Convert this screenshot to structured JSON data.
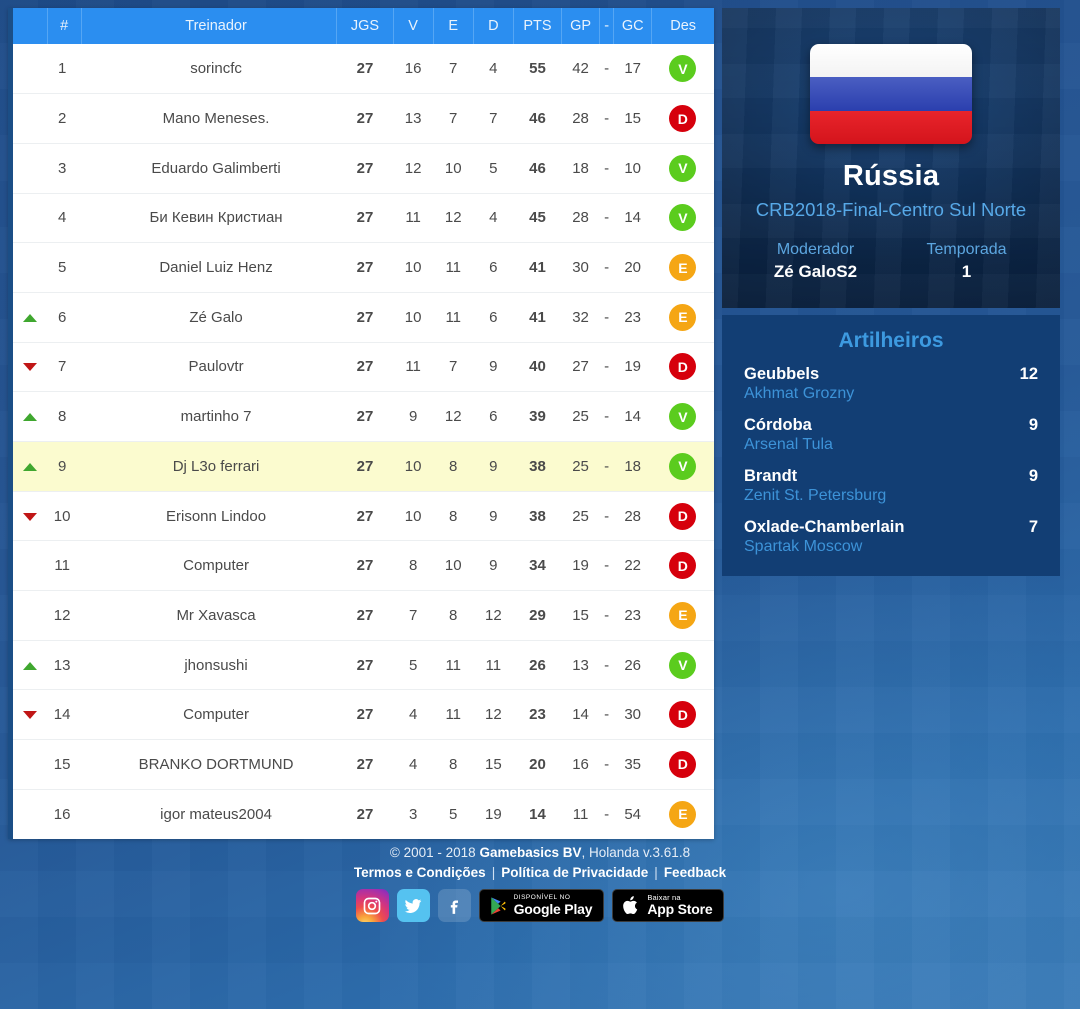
{
  "table": {
    "columns": {
      "arrow": "",
      "pos": "#",
      "name": "Treinador",
      "jgs": "JGS",
      "v": "V",
      "e": "E",
      "d": "D",
      "pts": "PTS",
      "gp": "GP",
      "dash": "-",
      "gc": "GC",
      "des": "Des"
    },
    "rows": [
      {
        "trend": "none",
        "pos": "1",
        "name": "sorincfc",
        "jgs": "27",
        "v": "16",
        "e": "7",
        "d": "4",
        "pts": "55",
        "gp": "42",
        "dash": "-",
        "gc": "17",
        "des": "V",
        "highlight": false
      },
      {
        "trend": "none",
        "pos": "2",
        "name": "Mano Meneses.",
        "jgs": "27",
        "v": "13",
        "e": "7",
        "d": "7",
        "pts": "46",
        "gp": "28",
        "dash": "-",
        "gc": "15",
        "des": "D",
        "highlight": false
      },
      {
        "trend": "none",
        "pos": "3",
        "name": "Eduardo Galimberti",
        "jgs": "27",
        "v": "12",
        "e": "10",
        "d": "5",
        "pts": "46",
        "gp": "18",
        "dash": "-",
        "gc": "10",
        "des": "V",
        "highlight": false
      },
      {
        "trend": "none",
        "pos": "4",
        "name": "Би Кевин Кристиан",
        "jgs": "27",
        "v": "11",
        "e": "12",
        "d": "4",
        "pts": "45",
        "gp": "28",
        "dash": "-",
        "gc": "14",
        "des": "V",
        "highlight": false
      },
      {
        "trend": "none",
        "pos": "5",
        "name": "Daniel Luiz Henz",
        "jgs": "27",
        "v": "10",
        "e": "11",
        "d": "6",
        "pts": "41",
        "gp": "30",
        "dash": "-",
        "gc": "20",
        "des": "E",
        "highlight": false
      },
      {
        "trend": "up",
        "pos": "6",
        "name": "Zé Galo",
        "jgs": "27",
        "v": "10",
        "e": "11",
        "d": "6",
        "pts": "41",
        "gp": "32",
        "dash": "-",
        "gc": "23",
        "des": "E",
        "highlight": false
      },
      {
        "trend": "down",
        "pos": "7",
        "name": "Paulovtr",
        "jgs": "27",
        "v": "11",
        "e": "7",
        "d": "9",
        "pts": "40",
        "gp": "27",
        "dash": "-",
        "gc": "19",
        "des": "D",
        "highlight": false
      },
      {
        "trend": "up",
        "pos": "8",
        "name": "martinho 7",
        "jgs": "27",
        "v": "9",
        "e": "12",
        "d": "6",
        "pts": "39",
        "gp": "25",
        "dash": "-",
        "gc": "14",
        "des": "V",
        "highlight": false
      },
      {
        "trend": "up",
        "pos": "9",
        "name": "Dj L3o ferrari",
        "jgs": "27",
        "v": "10",
        "e": "8",
        "d": "9",
        "pts": "38",
        "gp": "25",
        "dash": "-",
        "gc": "18",
        "des": "V",
        "highlight": true
      },
      {
        "trend": "down",
        "pos": "10",
        "name": "Erisonn Lindoo",
        "jgs": "27",
        "v": "10",
        "e": "8",
        "d": "9",
        "pts": "38",
        "gp": "25",
        "dash": "-",
        "gc": "28",
        "des": "D",
        "highlight": false
      },
      {
        "trend": "none",
        "pos": "11",
        "name": "Computer",
        "jgs": "27",
        "v": "8",
        "e": "10",
        "d": "9",
        "pts": "34",
        "gp": "19",
        "dash": "-",
        "gc": "22",
        "des": "D",
        "highlight": false
      },
      {
        "trend": "none",
        "pos": "12",
        "name": "Mr Xavasca",
        "jgs": "27",
        "v": "7",
        "e": "8",
        "d": "12",
        "pts": "29",
        "gp": "15",
        "dash": "-",
        "gc": "23",
        "des": "E",
        "highlight": false
      },
      {
        "trend": "up",
        "pos": "13",
        "name": "jhonsushi",
        "jgs": "27",
        "v": "5",
        "e": "11",
        "d": "11",
        "pts": "26",
        "gp": "13",
        "dash": "-",
        "gc": "26",
        "des": "V",
        "highlight": false
      },
      {
        "trend": "down",
        "pos": "14",
        "name": "Computer",
        "jgs": "27",
        "v": "4",
        "e": "11",
        "d": "12",
        "pts": "23",
        "gp": "14",
        "dash": "-",
        "gc": "30",
        "des": "D",
        "highlight": false
      },
      {
        "trend": "none",
        "pos": "15",
        "name": "BRANKO DORTMUND",
        "jgs": "27",
        "v": "4",
        "e": "8",
        "d": "15",
        "pts": "20",
        "gp": "16",
        "dash": "-",
        "gc": "35",
        "des": "D",
        "highlight": false
      },
      {
        "trend": "none",
        "pos": "16",
        "name": "igor mateus2004",
        "jgs": "27",
        "v": "3",
        "e": "5",
        "d": "19",
        "pts": "14",
        "gp": "11",
        "dash": "-",
        "gc": "54",
        "des": "E",
        "highlight": false
      }
    ]
  },
  "team_card": {
    "flag": "russia-flag",
    "name": "Rússia",
    "league": "CRB2018-Final-Centro Sul Norte",
    "moderator_label": "Moderador",
    "moderator_value": "Zé GaloS2",
    "season_label": "Temporada",
    "season_value": "1"
  },
  "scorers": {
    "title": "Artilheiros",
    "items": [
      {
        "name": "Geubbels",
        "club": "Akhmat Grozny",
        "goals": "12"
      },
      {
        "name": "Córdoba",
        "club": "Arsenal Tula",
        "goals": "9"
      },
      {
        "name": "Brandt",
        "club": "Zenit St. Petersburg",
        "goals": "9"
      },
      {
        "name": "Oxlade-Chamberlain",
        "club": "Spartak Moscow",
        "goals": "7"
      }
    ]
  },
  "footer": {
    "copyright_pre": "© 2001 - 2018 ",
    "company": "Gamebasics BV",
    "copyright_post": ", Holanda v.3.61.8",
    "terms": "Termos e Condições",
    "privacy": "Política de Privacidade",
    "feedback": "Feedback",
    "separator": "|",
    "google_play_small": "Disponível no",
    "google_play_big": "Google Play",
    "app_store_small": "Baixar na",
    "app_store_big": "App Store"
  },
  "colors": {
    "header_blue": "#2b8ef0",
    "win_green": "#5bcc1e",
    "loss_red": "#d6000c",
    "draw_orange": "#f5a614",
    "highlight_row": "#fbfbcf",
    "panel_blue": "#123e74"
  }
}
